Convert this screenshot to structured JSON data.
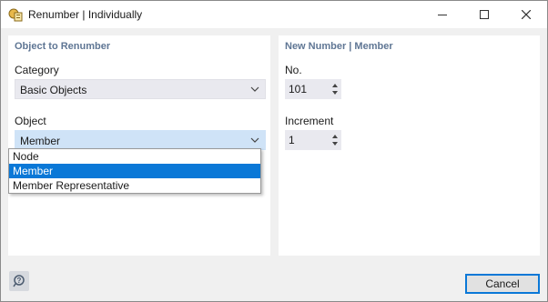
{
  "window": {
    "title": "Renumber | Individually"
  },
  "left_panel": {
    "title": "Object to Renumber",
    "category_label": "Category",
    "category_value": "Basic Objects",
    "object_label": "Object",
    "object_value": "Member",
    "object_options": [
      "Node",
      "Member",
      "Member Representative"
    ],
    "object_selected_index": 1
  },
  "right_panel": {
    "title": "New Number | Member",
    "no_label": "No.",
    "no_value": "101",
    "increment_label": "Increment",
    "increment_value": "1"
  },
  "footer": {
    "cancel_label": "Cancel"
  },
  "colors": {
    "accent": "#0a78d7",
    "section_title": "#5f7694",
    "combo_bg": "#e9e9ef",
    "combo_active_bg": "#cfe3f7"
  },
  "icons": [
    "app-icon",
    "minimize-icon",
    "maximize-icon",
    "close-icon",
    "chevron-down-icon",
    "spin-up-icon",
    "spin-down-icon",
    "help-icon"
  ]
}
